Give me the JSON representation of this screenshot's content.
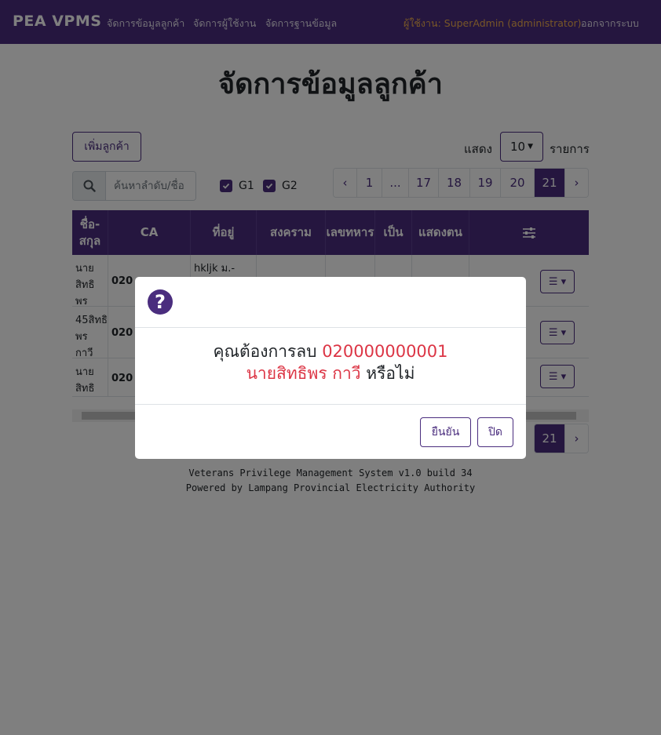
{
  "navbar": {
    "brand": "PEA  VPMS",
    "links": [
      "จัดการข้อมูลลูกค้า",
      "จัดการผู้ใช้งาน",
      "จัดการฐานข้อมูล"
    ],
    "user": "ผู้ใช้งาน: SuperAdmin (administrator)",
    "logout": "ออกจากระบบ"
  },
  "page": {
    "title": "จัดการข้อมูลลูกค้า",
    "add_button": "เพิ่มลูกค้า",
    "show_label": "แสดง",
    "page_size": "10",
    "show_suffix": "รายการ",
    "search_placeholder": "ค้นหาลำดับ/ชื่อ",
    "filters": [
      "G1",
      "G2"
    ]
  },
  "pagination": {
    "prev": "‹",
    "next": "›",
    "items": [
      "1",
      "...",
      "17",
      "18",
      "19",
      "20",
      "21"
    ],
    "active": "21"
  },
  "table": {
    "headers": [
      "ชื่อ-สกุล",
      "CA",
      "ที่อยู่",
      "สงคราม",
      "เลขทหาร",
      "เป็น",
      "แสดงตน"
    ],
    "rows": [
      {
        "name": "นายสิทธิพร  กาวี",
        "ca": "020",
        "address": "hkljk ม.-"
      },
      {
        "name": "45สิทธิพร  กาวี",
        "ca": "020",
        "address": ""
      },
      {
        "name": "นายสิทธิพร  กาวี",
        "ca": "020",
        "address": ""
      }
    ]
  },
  "footer": {
    "line1": "Veterans Privilege Management System v1.0 build 34",
    "line2": "Powered by Lampang Provincial Electricity Authority"
  },
  "modal": {
    "icon": "question-circle-icon",
    "prefix": "คุณต้องการลบ",
    "ca_number": "020000000001",
    "customer_name": "นายสิทธิพร   กาวี",
    "suffix": "หรือไม่",
    "confirm": "ยืนยัน",
    "close": "ปิด"
  },
  "colors": {
    "primary": "#4a2d7e",
    "warning": "#f0ad4e",
    "danger": "#dc3545"
  }
}
